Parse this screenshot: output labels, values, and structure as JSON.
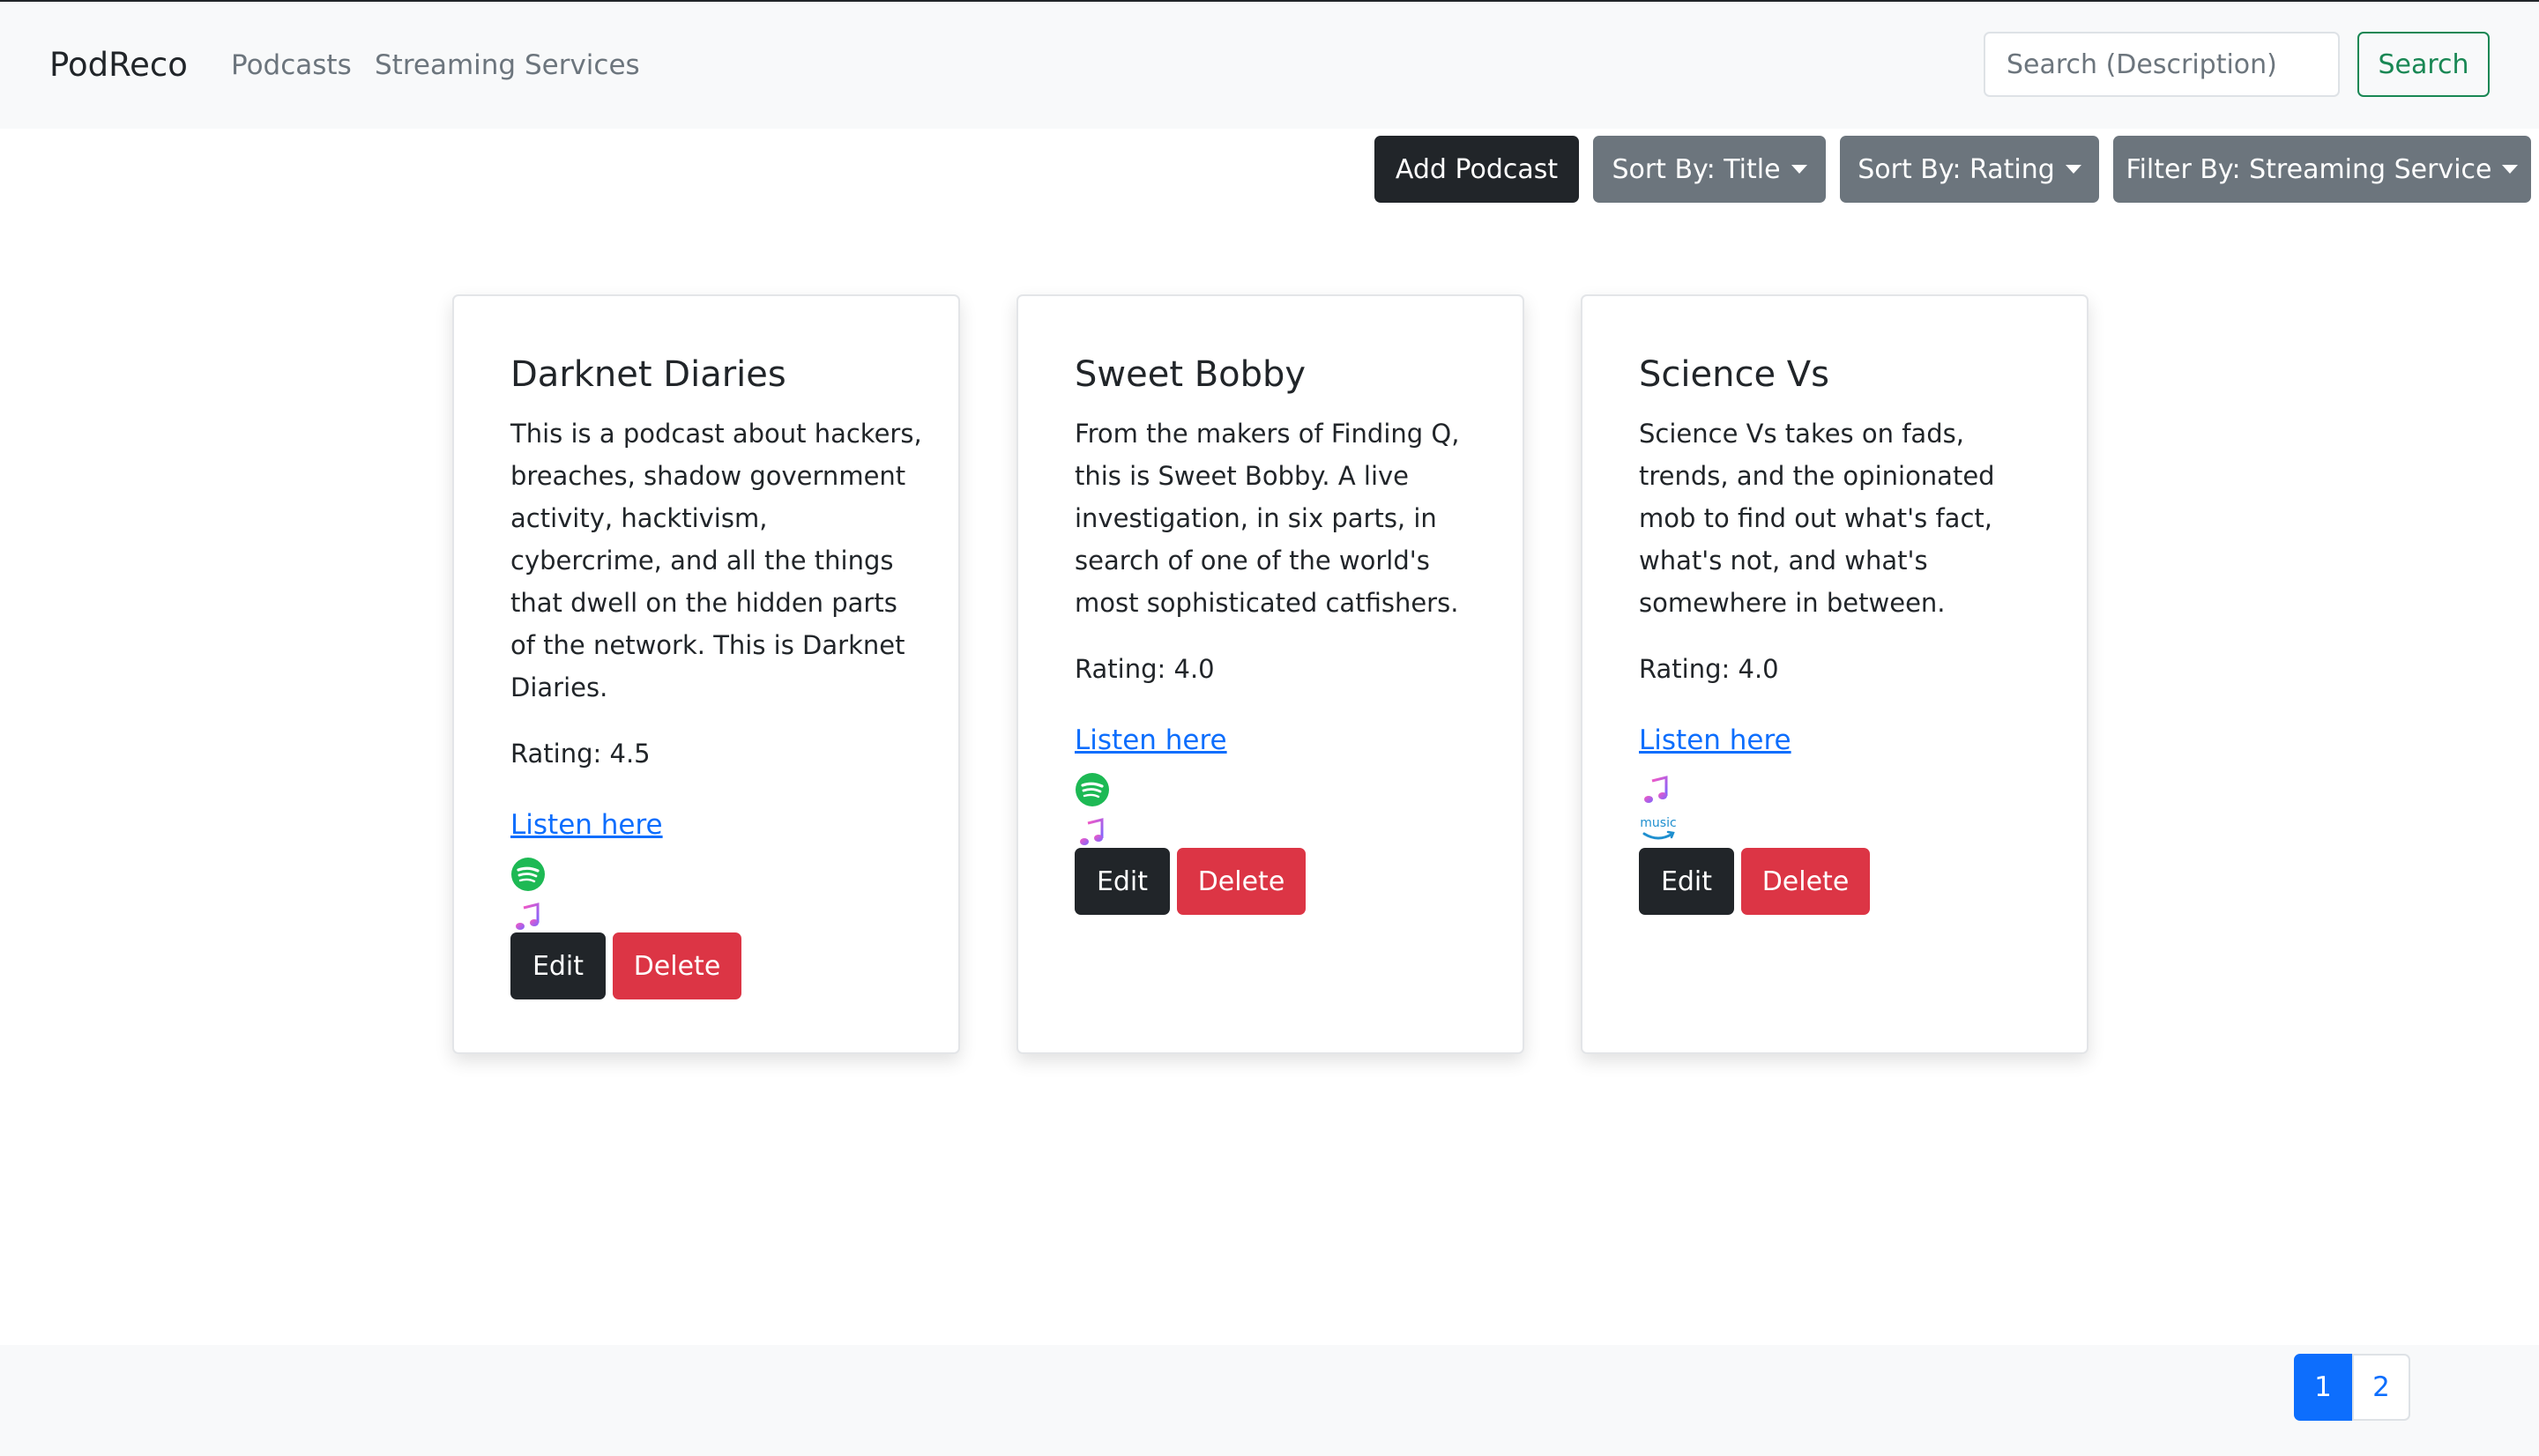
{
  "navbar": {
    "brand": "PodReco",
    "links": [
      "Podcasts",
      "Streaming Services"
    ],
    "search_placeholder": "Search (Description)",
    "search_button": "Search"
  },
  "toolbar": {
    "add_podcast": "Add Podcast",
    "sort_title": "Sort By: Title",
    "sort_rating": "Sort By: Rating",
    "filter_service": "Filter By: Streaming Service"
  },
  "cards": [
    {
      "title": "Darknet Diaries",
      "description": "This is a podcast about hackers, breaches, shadow government activity, hacktivism, cybercrime, and all the things that dwell on the hidden parts of the network. This is Darknet Diaries.",
      "rating": "Rating: 4.5",
      "link": "Listen here",
      "services": [
        "spotify-icon",
        "apple-music-icon"
      ],
      "edit": "Edit",
      "delete": "Delete"
    },
    {
      "title": "Sweet Bobby",
      "description": "From the makers of Finding Q, this is Sweet Bobby. A live investigation, in six parts, in search of one of the world's most sophisticated catfishers.",
      "rating": "Rating: 4.0",
      "link": "Listen here",
      "services": [
        "spotify-icon",
        "apple-music-icon"
      ],
      "edit": "Edit",
      "delete": "Delete"
    },
    {
      "title": "Science Vs",
      "description": "Science Vs takes on fads, trends, and the opinionated mob to find out what's fact, what's not, and what's somewhere in between.",
      "rating": "Rating: 4.0",
      "link": "Listen here",
      "services": [
        "apple-music-icon",
        "amazon-music-icon"
      ],
      "amazon_text": "music",
      "edit": "Edit",
      "delete": "Delete"
    }
  ],
  "pagination": {
    "pages": [
      "1",
      "2"
    ],
    "active": "1"
  },
  "colors": {
    "primary": "#0d6efd",
    "dark": "#212529",
    "secondary": "#6c757d",
    "danger": "#dc3545",
    "success": "#198754",
    "spotify": "#1db954"
  }
}
